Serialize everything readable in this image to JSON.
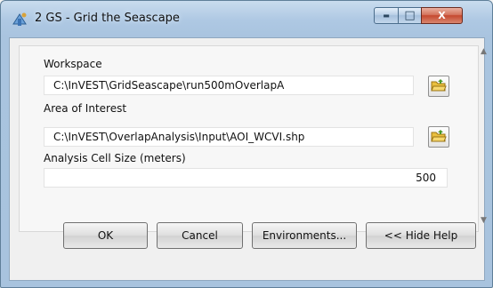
{
  "window": {
    "title": "2 GS - Grid the Seascape",
    "controls": {
      "minimize": "▬",
      "maximize": "□",
      "close": "X"
    },
    "icon": "arcgis-toolbox-icon"
  },
  "form": {
    "workspace": {
      "label": "Workspace",
      "value": "C:\\InVEST\\GridSeascape\\run500mOverlapA",
      "browse_icon": "open-folder-icon"
    },
    "aoi": {
      "label": "Area of Interest",
      "value": "C:\\InVEST\\OverlapAnalysis\\Input\\AOI_WCVI.shp",
      "browse_icon": "open-folder-icon"
    },
    "cell_size": {
      "label": "Analysis Cell Size (meters)",
      "value": "500"
    }
  },
  "buttons": {
    "ok": "OK",
    "cancel": "Cancel",
    "environments": "Environments...",
    "hide_help": "<< Hide Help"
  }
}
